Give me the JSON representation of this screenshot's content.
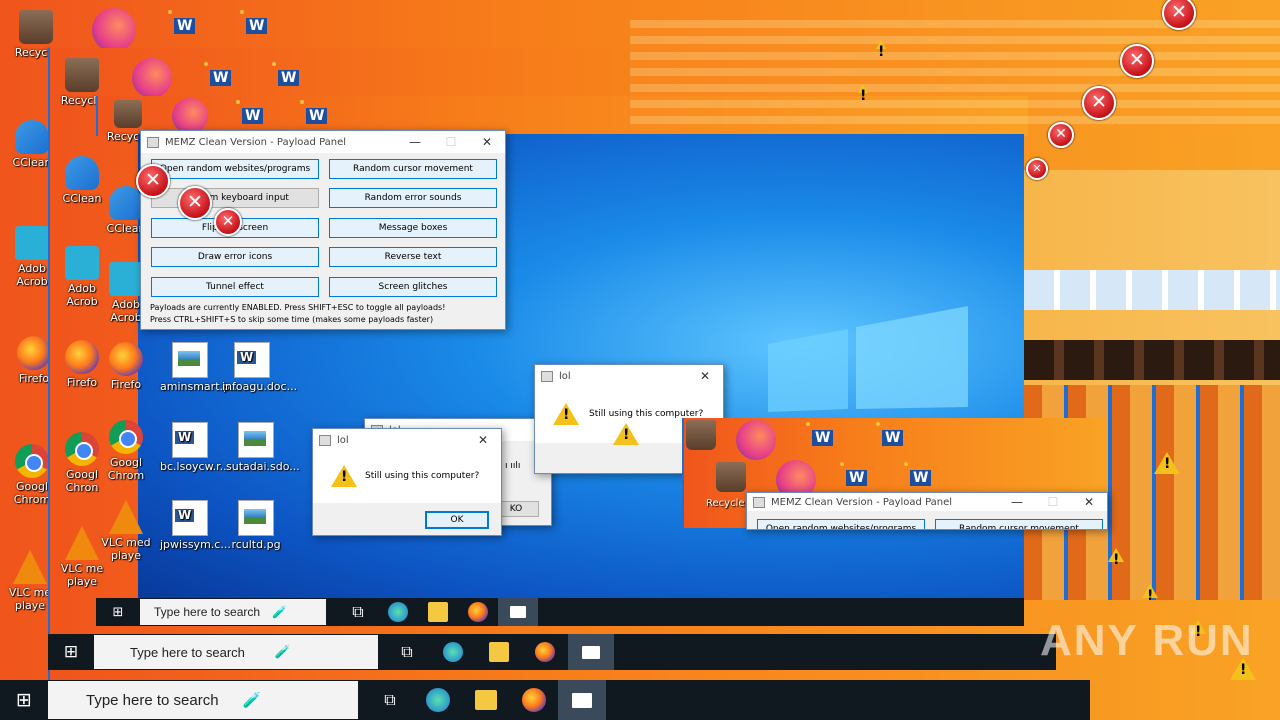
{
  "desktop_icons": [
    {
      "label": "Recycle",
      "icon": "recycle-bin-icon"
    },
    {
      "label": "CClean",
      "icon": "ccleaner-icon"
    },
    {
      "label": "Adob Acrob",
      "icon": "acrobat-icon"
    },
    {
      "label": "Firefo",
      "icon": "firefox-icon"
    },
    {
      "label": "Googl Chrom",
      "icon": "chrome-icon"
    },
    {
      "label": "VLC me playe",
      "icon": "vlc-icon"
    }
  ],
  "layer2_icons": [
    "Recycle",
    "CClean",
    "Adob Acrob",
    "Firefo",
    "Googl Chron",
    "VLC me playe"
  ],
  "layer3_icons": [
    "Recycle",
    "CClean",
    "Adob Acrob",
    "Firefo",
    "Googl Chrom",
    "VLC med playe"
  ],
  "files": [
    "aminsmart.p...",
    "infoagu.doc...",
    "bc.lsoycw.r...",
    "sutadai.sdo...",
    "jpwissym.c...",
    "rcultd.pg"
  ],
  "payload_panel": {
    "title": "MEMZ Clean Version - Payload Panel",
    "buttons": [
      "Open random websites/programs",
      "Random cursor movement",
      "Random keyboard input",
      "Random error sounds",
      "Flip the screen",
      "Message boxes",
      "Draw error icons",
      "Reverse text",
      "Tunnel effect",
      "Screen glitches"
    ],
    "status_line1": "Payloads are currently ENABLED. Press SHIFT+ESC to toggle all payloads!",
    "status_line2": "Press CTRL+SHIFT+S to skip some time (makes some payloads faster)"
  },
  "payload_panel_small": {
    "title": "MEMZ Clean Version - Payload Panel",
    "button1": "Open random websites/programs",
    "button2": "Random cursor movement"
  },
  "msgbox": {
    "title": "lol",
    "message": "Still using this computer?",
    "ok_label": "OK"
  },
  "msgbox_back": {
    "title": "lol",
    "message_fragment": "ı ıılı",
    "ok_label": "KO"
  },
  "msgbox_right": {
    "title": "lol",
    "message": "Still using this computer?"
  },
  "taskbar": {
    "search_placeholder": "Type here to search",
    "start_glyph": "⊞",
    "taskview_glyph": "⧉"
  },
  "watermark": "ANY RUN",
  "colors": {
    "accent": "#0078d7",
    "orange": "#f77d1a",
    "blue": "#1a8ae8",
    "taskbar": "#101820"
  }
}
